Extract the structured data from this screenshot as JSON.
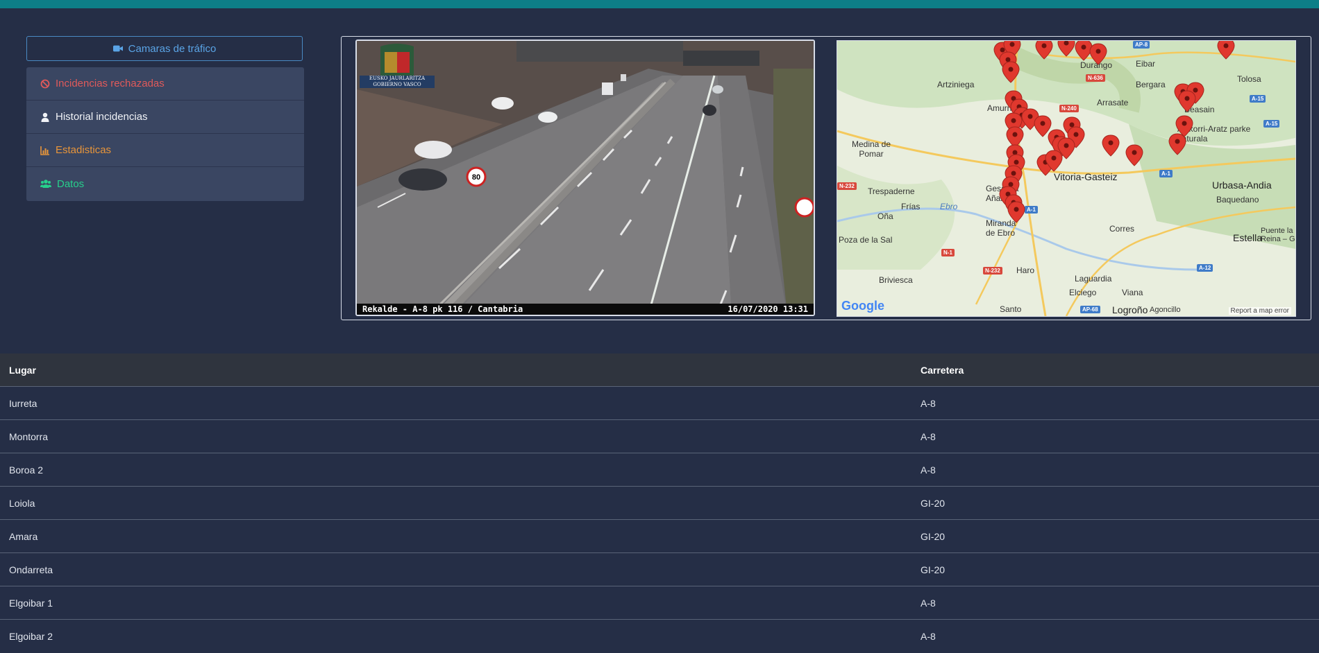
{
  "sidebar": {
    "camera_button": "Camaras de tráfico",
    "items": [
      {
        "label": "Incidencias rechazadas",
        "icon": "ban-icon"
      },
      {
        "label": "Historial incidencias",
        "icon": "user-icon"
      },
      {
        "label": "Estadisticas",
        "icon": "chart-icon"
      },
      {
        "label": "Datos",
        "icon": "users-icon"
      }
    ]
  },
  "camera": {
    "caption_left": "Rekalde - A-8 pk 116 / Cantabria",
    "caption_right": "16/07/2020 13:31",
    "logo_line1": "EUSKO JAURLARITZA",
    "logo_line2": "GOBIERNO VASCO",
    "speed_sign": "80"
  },
  "map": {
    "labels": [
      "Artziniega",
      "Durango",
      "Eibar",
      "Bergara",
      "Tolosa",
      "Amurrio",
      "Arrasate",
      "Aizkorri-Aratz parke naturala",
      "Beasain",
      "Medina de Pomar",
      "Vitoria-Gasteiz",
      "Trespaderne",
      "Frías",
      "Ebro",
      "Oña",
      "Gesaltza Añana",
      "Urbasa-Andia",
      "Baquedano",
      "Poza de la Sal",
      "Miranda de Ebro",
      "Corres",
      "Estella",
      "Puente la Reina – G",
      "Briviesca",
      "Haro",
      "Laguardia",
      "Elciego",
      "Viana",
      "Logroño",
      "Agoncillo",
      "Santo"
    ],
    "roads": [
      "AP-8",
      "N-636",
      "N-240",
      "A-15",
      "A-15",
      "A-1",
      "A-1",
      "N-232",
      "N-1",
      "N-232",
      "AP-68",
      "A-12"
    ],
    "attribution": "Report a map error",
    "provider": "Google"
  },
  "table": {
    "headers": [
      "Lugar",
      "Carretera"
    ],
    "rows": [
      [
        "Iurreta",
        "A-8"
      ],
      [
        "Montorra",
        "A-8"
      ],
      [
        "Boroa 2",
        "A-8"
      ],
      [
        "Loiola",
        "GI-20"
      ],
      [
        "Amara",
        "GI-20"
      ],
      [
        "Ondarreta",
        "GI-20"
      ],
      [
        "Elgoibar 1",
        "A-8"
      ],
      [
        "Elgoibar 2",
        "A-8"
      ]
    ]
  }
}
